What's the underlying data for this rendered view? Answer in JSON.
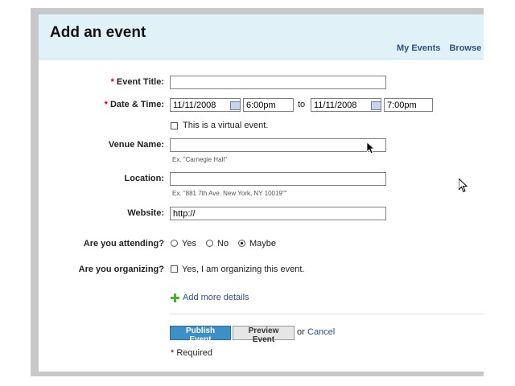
{
  "header": {
    "title": "Add an event",
    "links": [
      "My Events",
      "Browse E"
    ]
  },
  "form": {
    "event_title": {
      "required_mark": "*",
      "label": "Event Title:",
      "value": ""
    },
    "date_time": {
      "required_mark": "*",
      "label": "Date & Time:",
      "start_date": "11/11/2008",
      "start_time": "6:00pm",
      "to_label": "to",
      "end_date": "11/11/2008",
      "end_time": "7:00pm"
    },
    "virtual": {
      "label": "This is a virtual event.",
      "checked": false
    },
    "venue": {
      "label": "Venue Name:",
      "value": "",
      "hint": "Ex. \"Carnegie Hall\""
    },
    "location": {
      "label": "Location:",
      "value": "",
      "hint": "Ex. \"881 7th Ave. New York, NY 10019\"\""
    },
    "website": {
      "label": "Website:",
      "value": "http://"
    },
    "attending": {
      "label": "Are you attending?",
      "options": [
        "Yes",
        "No",
        "Maybe"
      ],
      "selected": "Maybe"
    },
    "organizing": {
      "label": "Are you organizing?",
      "checkbox_label": "Yes, I am organizing this event.",
      "checked": false
    },
    "more_details": "Add more details",
    "publish": "Publish Event",
    "preview": "Preview Event",
    "or_text": "or",
    "cancel": "Cancel",
    "required_note": "* Required"
  }
}
